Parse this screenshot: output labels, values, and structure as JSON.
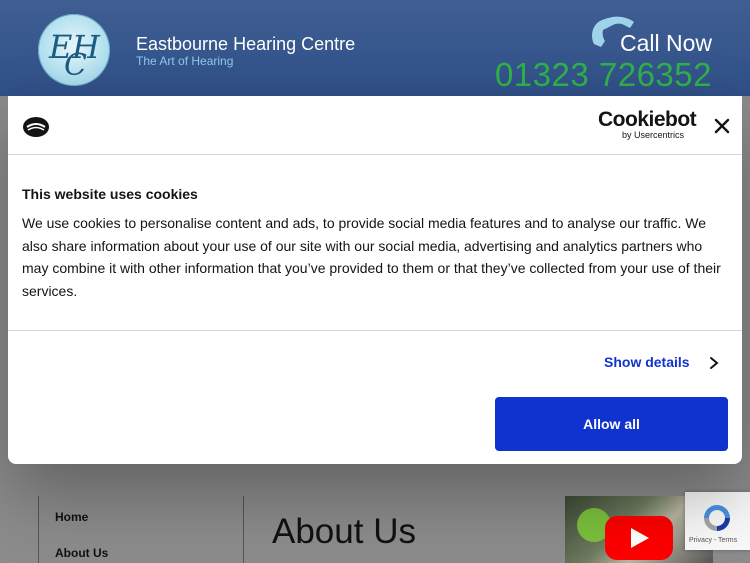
{
  "header": {
    "logo_letters": [
      "E",
      "H",
      "C"
    ],
    "site_title": "Eastbourne Hearing Centre",
    "tagline": "The Art of Hearing",
    "call_label": "Call Now",
    "phone_number": "01323 726352"
  },
  "nav": {
    "items": [
      {
        "label": "Home"
      },
      {
        "label": "About Us"
      }
    ]
  },
  "page": {
    "title": "About Us"
  },
  "cookie_dialog": {
    "brand": "Cookiebot",
    "brand_sub": "by Usercentrics",
    "heading": "This website uses cookies",
    "body": "We use cookies to personalise content and ads, to provide social media features and to analyse our traffic. We also share information about your use of our site with our social media, advertising and analytics partners who may combine it with other information that you’ve provided to them or that they’ve collected from your use of their services.",
    "show_details_label": "Show details",
    "allow_all_label": "Allow all"
  },
  "recaptcha": {
    "footer": "Privacy - Terms"
  },
  "colors": {
    "header_bg": "#2f5088",
    "phone_green": "#2fb24a",
    "accent_blue": "#1032cf"
  },
  "icons": [
    "phone-icon",
    "cookie-icon",
    "close-icon",
    "chevron-right-icon",
    "youtube-play-icon",
    "recaptcha-icon"
  ]
}
